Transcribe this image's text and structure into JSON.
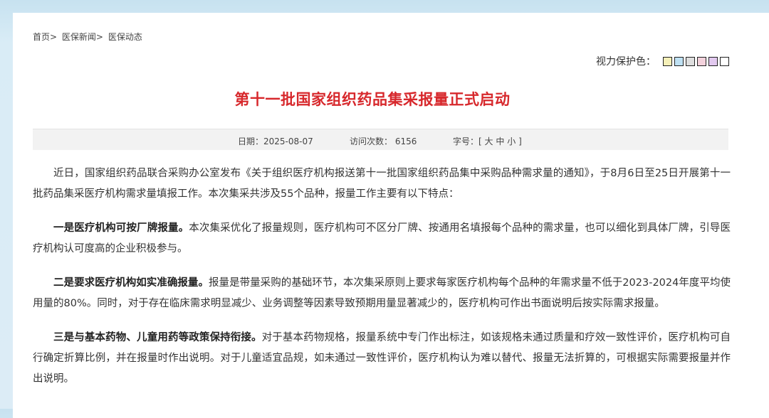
{
  "breadcrumb": {
    "home": "首页",
    "sep": ">",
    "news": "医保新闻",
    "section": "医保动态"
  },
  "eye_care": {
    "label": "视力保护色：",
    "swatches": [
      "#f5f0b8",
      "#bfe1f3",
      "#dedede",
      "#f3d2dc",
      "#e2c9ef",
      "#ffffff"
    ]
  },
  "article": {
    "title": "第十一批国家组织药品集采报量正式启动",
    "date_label": "日期：",
    "date": "2025-08-07",
    "visits_label": "访问次数：",
    "visits": "6156",
    "font_label": "字号：",
    "font_open": "[",
    "font_large": "大",
    "font_medium": "中",
    "font_small": "小",
    "font_close": "]",
    "paragraphs": [
      {
        "bold": "",
        "text": "近日，国家组织药品联合采购办公室发布《关于组织医疗机构报送第十一批国家组织药品集中采购品种需求量的通知》，于8月6日至25日开展第十一批药品集采医疗机构需求量填报工作。本次集采共涉及55个品种，报量工作主要有以下特点："
      },
      {
        "bold": "一是医疗机构可按厂牌报量。",
        "text": "本次集采优化了报量规则，医疗机构可不区分厂牌、按通用名填报每个品种的需求量，也可以细化到具体厂牌，引导医疗机构认可度高的企业积极参与。"
      },
      {
        "bold": "二是要求医疗机构如实准确报量。",
        "text": "报量是带量采购的基础环节，本次集采原则上要求每家医疗机构每个品种的年需求量不低于2023-2024年度平均使用量的80%。同时，对于存在临床需求明显减少、业务调整等因素导致预期用量显著减少的，医疗机构可作出书面说明后按实际需求报量。"
      },
      {
        "bold": "三是与基本药物、儿童用药等政策保持衔接。",
        "text": "对于基本药物规格，报量系统中专门作出标注，如该规格未通过质量和疗效一致性评价，医疗机构可自行确定折算比例，并在报量时作出说明。对于儿童适宜品规，如未通过一致性评价，医疗机构认为难以替代、报量无法折算的，可根据实际需要报量并作出说明。"
      }
    ]
  }
}
